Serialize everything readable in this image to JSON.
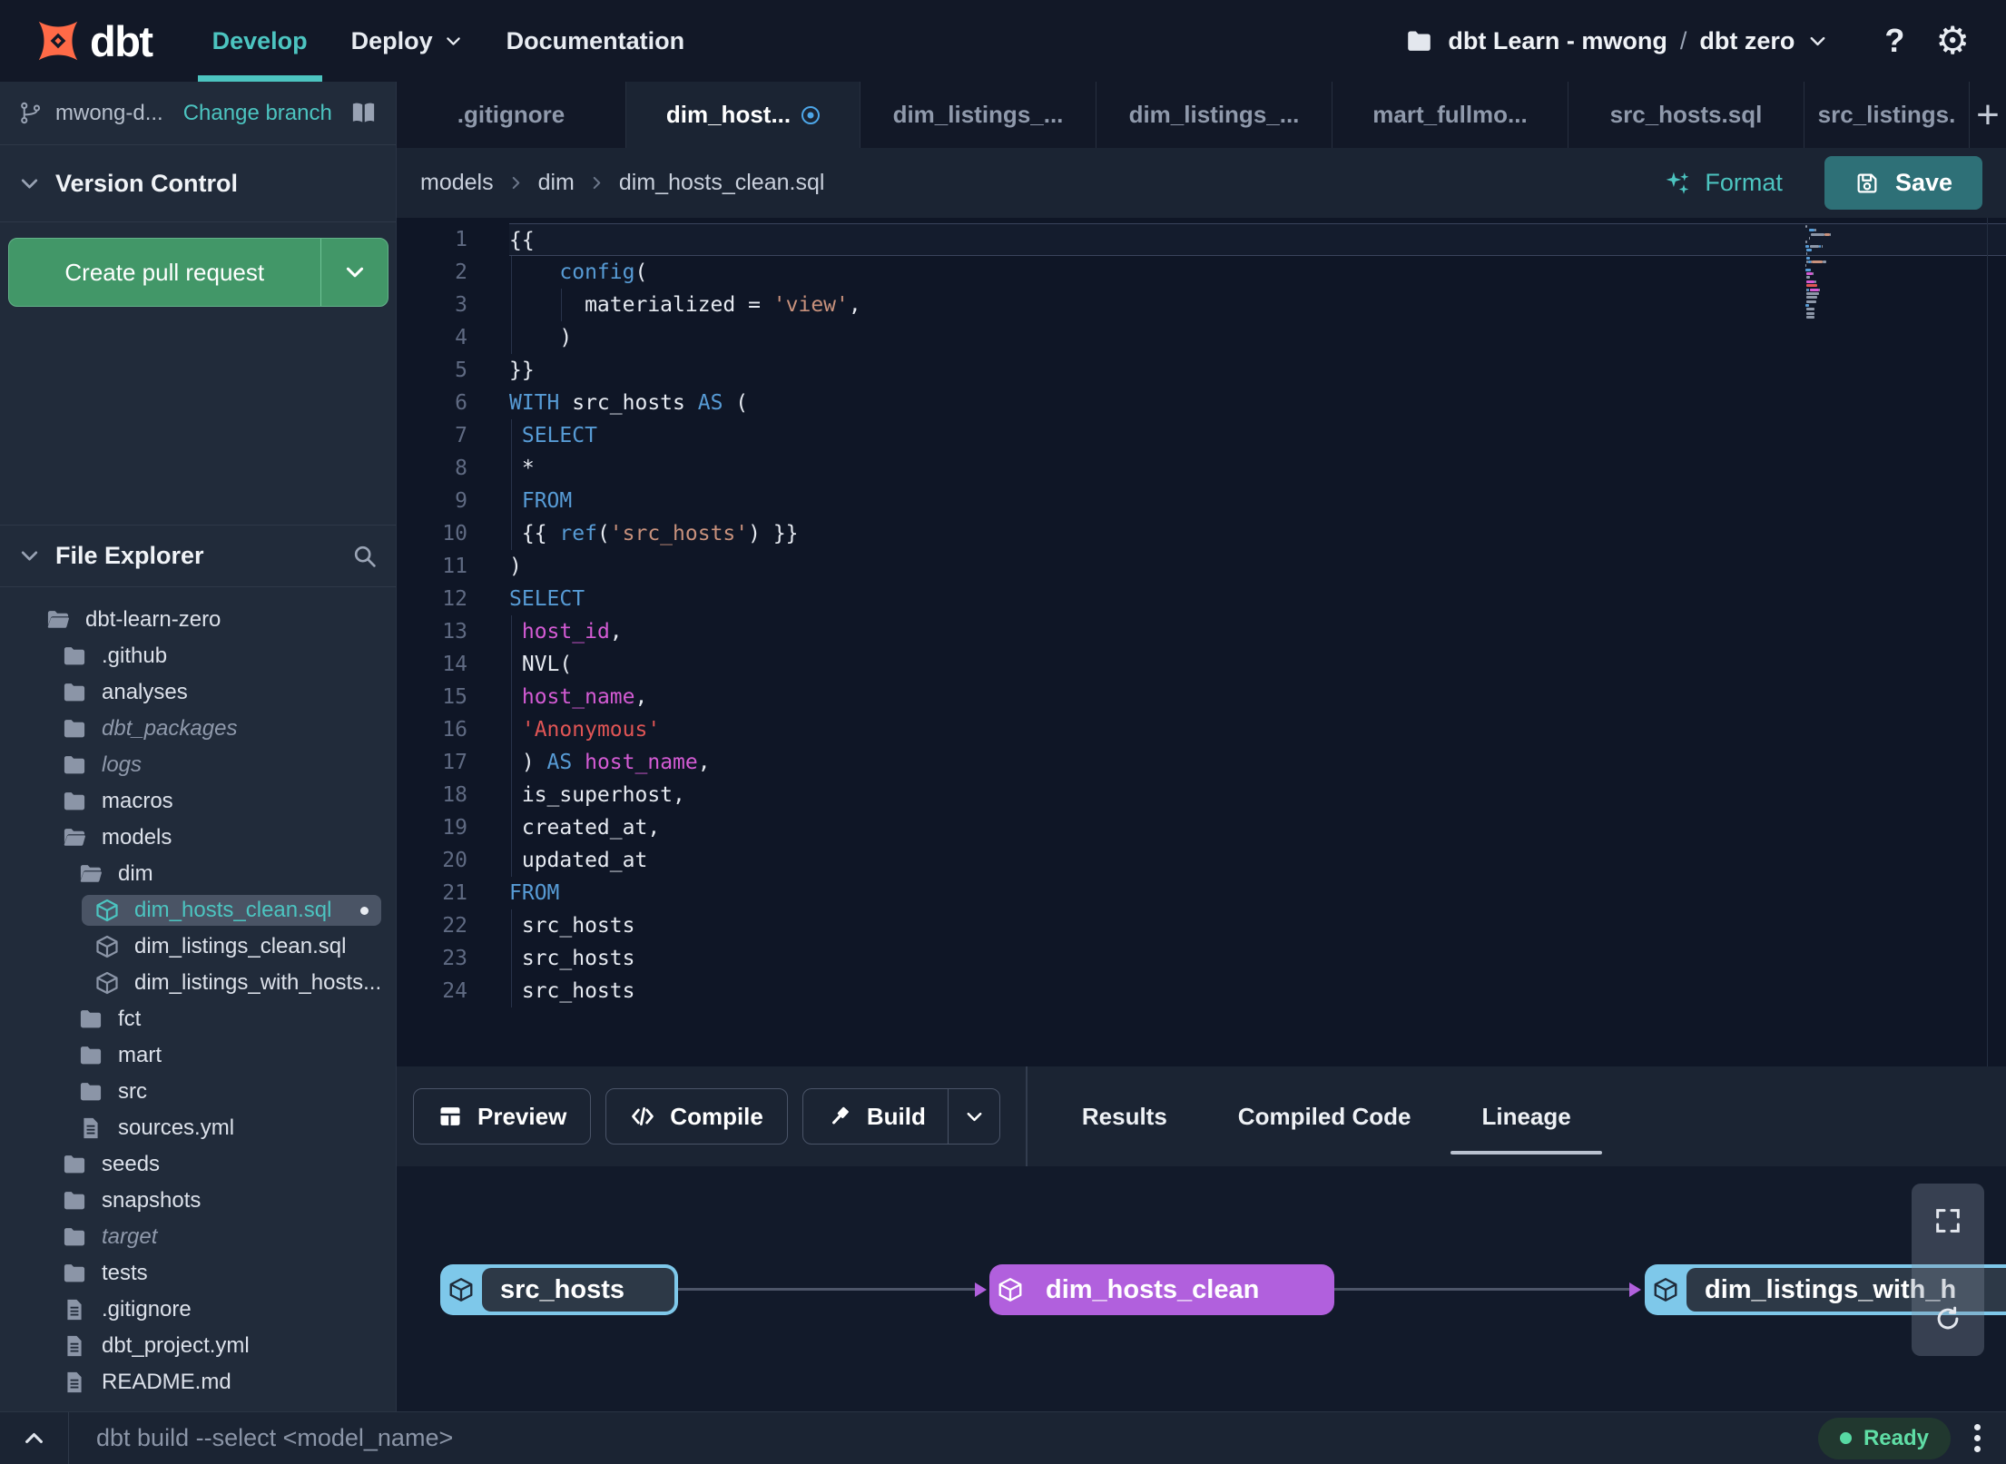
{
  "navbar": {
    "logo_text": "dbt",
    "links": [
      {
        "label": "Develop",
        "active": true
      },
      {
        "label": "Deploy",
        "chevron": true
      },
      {
        "label": "Documentation"
      }
    ],
    "project_name": "dbt Learn - mwong",
    "separator": "/",
    "environment": "dbt zero",
    "help_label": "?"
  },
  "sidebar": {
    "branch_name": "mwong-d...",
    "change_branch_label": "Change branch",
    "version_control_title": "Version Control",
    "create_pr_label": "Create pull request",
    "file_explorer_title": "File Explorer",
    "tree": [
      {
        "label": "dbt-learn-zero",
        "type": "folder-open",
        "depth": 0
      },
      {
        "label": ".github",
        "type": "folder",
        "depth": 1
      },
      {
        "label": "analyses",
        "type": "folder",
        "depth": 1
      },
      {
        "label": "dbt_packages",
        "type": "folder",
        "depth": 1,
        "italic": true
      },
      {
        "label": "logs",
        "type": "folder",
        "depth": 1,
        "italic": true
      },
      {
        "label": "macros",
        "type": "folder",
        "depth": 1
      },
      {
        "label": "models",
        "type": "folder-open",
        "depth": 1
      },
      {
        "label": "dim",
        "type": "folder-open",
        "depth": 2
      },
      {
        "label": "dim_hosts_clean.sql",
        "type": "model",
        "depth": 3,
        "selected": true,
        "modified": true
      },
      {
        "label": "dim_listings_clean.sql",
        "type": "model",
        "depth": 3
      },
      {
        "label": "dim_listings_with_hosts...",
        "type": "model",
        "depth": 3
      },
      {
        "label": "fct",
        "type": "folder",
        "depth": 2
      },
      {
        "label": "mart",
        "type": "folder",
        "depth": 2
      },
      {
        "label": "src",
        "type": "folder",
        "depth": 2
      },
      {
        "label": "sources.yml",
        "type": "file",
        "depth": 2
      },
      {
        "label": "seeds",
        "type": "folder",
        "depth": 1
      },
      {
        "label": "snapshots",
        "type": "folder",
        "depth": 1
      },
      {
        "label": "target",
        "type": "folder",
        "depth": 1,
        "italic": true
      },
      {
        "label": "tests",
        "type": "folder",
        "depth": 1
      },
      {
        "label": ".gitignore",
        "type": "file",
        "depth": 1
      },
      {
        "label": "dbt_project.yml",
        "type": "file",
        "depth": 1
      },
      {
        "label": "README.md",
        "type": "file",
        "depth": 1
      }
    ]
  },
  "editor": {
    "tabs": [
      {
        "label": ".gitignore"
      },
      {
        "label": "dim_host...",
        "active": true,
        "modified": true
      },
      {
        "label": "dim_listings_..."
      },
      {
        "label": "dim_listings_..."
      },
      {
        "label": "mart_fullmo..."
      },
      {
        "label": "src_hosts.sql"
      },
      {
        "label": "src_listings."
      }
    ],
    "new_tab_label": "+",
    "breadcrumb": [
      "models",
      "dim",
      "dim_hosts_clean.sql"
    ],
    "format_label": "Format",
    "save_label": "Save",
    "code_lines": [
      {
        "s": [
          [
            "{{",
            "p"
          ]
        ]
      },
      {
        "s": [
          [
            "    ",
            "p"
          ],
          [
            "config",
            "k"
          ],
          [
            "(",
            "p"
          ]
        ],
        "g": [
          2
        ]
      },
      {
        "s": [
          [
            "      materialized = ",
            "p"
          ],
          [
            "'view'",
            "s"
          ],
          [
            ",",
            "p"
          ]
        ],
        "g": [
          2,
          57
        ]
      },
      {
        "s": [
          [
            "    )",
            "p"
          ]
        ],
        "g": [
          2
        ]
      },
      {
        "s": [
          [
            "}}",
            "p"
          ]
        ]
      },
      {
        "s": [
          [
            "WITH",
            "k"
          ],
          [
            " src_hosts ",
            "p"
          ],
          [
            "AS",
            "k"
          ],
          [
            " (",
            "p"
          ]
        ]
      },
      {
        "s": [
          [
            " ",
            "p"
          ],
          [
            "SELECT",
            "k"
          ]
        ],
        "g": [
          2
        ]
      },
      {
        "s": [
          [
            " *",
            "p"
          ]
        ],
        "g": [
          2
        ]
      },
      {
        "s": [
          [
            " ",
            "p"
          ],
          [
            "FROM",
            "k"
          ]
        ],
        "g": [
          2
        ]
      },
      {
        "s": [
          [
            " {{ ",
            "p"
          ],
          [
            "ref",
            "k"
          ],
          [
            "(",
            "p"
          ],
          [
            "'src_hosts'",
            "s"
          ],
          [
            ") }}",
            "p"
          ]
        ],
        "g": [
          2
        ]
      },
      {
        "s": [
          [
            ")",
            "p"
          ]
        ]
      },
      {
        "s": [
          [
            "SELECT",
            "k"
          ]
        ]
      },
      {
        "s": [
          [
            " ",
            "p"
          ],
          [
            "host_id",
            "i"
          ],
          [
            ",",
            "p"
          ]
        ],
        "g": [
          2
        ]
      },
      {
        "s": [
          [
            " NVL(",
            "p"
          ]
        ],
        "g": [
          2
        ]
      },
      {
        "s": [
          [
            " ",
            "p"
          ],
          [
            "host_name",
            "i"
          ],
          [
            ",",
            "p"
          ]
        ],
        "g": [
          2
        ]
      },
      {
        "s": [
          [
            " ",
            "p"
          ],
          [
            "'Anonymous'",
            "r"
          ]
        ],
        "g": [
          2
        ]
      },
      {
        "s": [
          [
            " ) ",
            "p"
          ],
          [
            "AS",
            "k"
          ],
          [
            " ",
            "p"
          ],
          [
            "host_name",
            "i"
          ],
          [
            ",",
            "p"
          ]
        ],
        "g": [
          2
        ]
      },
      {
        "s": [
          [
            " is_superhost,",
            "p"
          ]
        ],
        "g": [
          2
        ]
      },
      {
        "s": [
          [
            " created_at,",
            "p"
          ]
        ],
        "g": [
          2
        ]
      },
      {
        "s": [
          [
            " updated_at",
            "p"
          ]
        ],
        "g": [
          2
        ]
      },
      {
        "s": [
          [
            "FROM",
            "k"
          ]
        ]
      },
      {
        "s": [
          [
            " src_hosts",
            "p"
          ]
        ],
        "g": [
          2
        ]
      },
      {
        "s": [
          [
            " src_hosts",
            "p"
          ]
        ],
        "g": [
          2
        ]
      },
      {
        "s": [
          [
            " src_hosts",
            "p"
          ]
        ],
        "g": [
          2
        ]
      }
    ]
  },
  "bottom_panel": {
    "buttons": [
      {
        "label": "Preview",
        "icon": "table-icon"
      },
      {
        "label": "Compile",
        "icon": "code-icon"
      },
      {
        "label": "Build",
        "icon": "hammer-icon",
        "split": true
      }
    ],
    "tabs": [
      {
        "label": "Results"
      },
      {
        "label": "Compiled Code"
      },
      {
        "label": "Lineage",
        "active": true
      }
    ],
    "lineage_nodes": [
      {
        "label": "src_hosts",
        "variant": "source"
      },
      {
        "label": "dim_hosts_clean",
        "variant": "highlight"
      },
      {
        "label": "dim_listings_with_h",
        "variant": "source"
      }
    ]
  },
  "command_bar": {
    "command_placeholder": "dbt build --select <model_name>",
    "status_label": "Ready"
  },
  "colors": {
    "accent_teal": "#4cc4c0",
    "accent_green": "#429768",
    "accent_purple": "#b160dd",
    "node_blue": "#7ec8ea",
    "modified_blue": "#4da6e8",
    "status_green": "#57d9a3",
    "logo_orange": "#ff6a47"
  }
}
